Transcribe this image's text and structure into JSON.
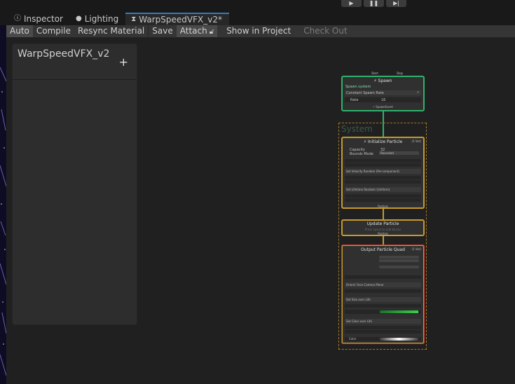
{
  "tabs": [
    {
      "label": "Inspector",
      "icon": "info-icon"
    },
    {
      "label": "Lighting",
      "icon": "lightbulb-icon"
    },
    {
      "label": "WarpSpeedVFX_v2*",
      "icon": "vfx-graph-icon"
    }
  ],
  "toolbar": {
    "auto": "Auto",
    "compile": "Compile",
    "resync": "Resync Material",
    "save": "Save",
    "attach": "Attach",
    "show_in_project": "Show in Project",
    "check_out": "Check Out"
  },
  "blackboard": {
    "title": "WarpSpeedVFX_v2",
    "add": "+"
  },
  "graph": {
    "spawn": {
      "title": "Spawn",
      "subtitle": "Spawn system",
      "block": "Constant Spawn Rate",
      "rate_label": "Rate",
      "rate_value": "16",
      "footer": "SpawnEvent",
      "port_left": "Start",
      "port_right": "Stop"
    },
    "system_label": "System",
    "init": {
      "title": "Initialize Particle",
      "tag": "(1 Var)",
      "capacity_label": "Capacity",
      "capacity_value": "32",
      "bounds_label": "Bounds Mode",
      "bounds_value": "Recorded",
      "block1": "Set Velocity Random (Per-component)",
      "block2": "Set Lifetime Random (Uniform)",
      "footer": "Particle"
    },
    "update": {
      "title": "Update Particle",
      "hint": "Press space to add blocks",
      "footer": "Particle"
    },
    "output": {
      "title": "Output Particle Quad",
      "tag": "(1 Var)",
      "block_facing": "Orient: Face Camera Plane",
      "block_size": "Set Size over Life",
      "block_color": "Set Color over Life",
      "color_label": "Color"
    }
  },
  "colors": {
    "accent_tab": "#3a79bb",
    "spawn_border": "#2fb36c",
    "system_border": "#c79a2b",
    "output_border": "#c0392b"
  }
}
